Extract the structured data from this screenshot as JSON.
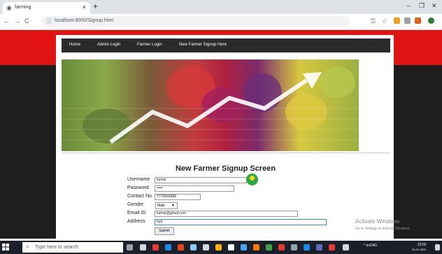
{
  "browser": {
    "tab_title": "farming",
    "url": "localhost:8000/Signup.html"
  },
  "nav": {
    "items": [
      "Home",
      "Admin Login",
      "Farmer Login",
      "New Farmer Signup Here"
    ]
  },
  "form": {
    "heading": "New Farmer Signup Screen",
    "username_label": "Username",
    "username_value": "kumar",
    "password_label": "Password",
    "password_value": "•••••",
    "contact_label": "Contact No",
    "contact_value": "7776666888",
    "gender_label": "Gender",
    "gender_value": "Male",
    "email_label": "Email ID",
    "email_value": "kumar@gmail.com",
    "address_label": "Address",
    "address_value": "hyd",
    "submit_label": "Submit"
  },
  "watermark": {
    "title": "Activate Windows",
    "subtitle": "Go to Settings to activate Windows."
  },
  "taskbar": {
    "search_placeholder": "Type here to search",
    "time": "22:02",
    "date": "26-01-2022"
  },
  "colors": {
    "header_red": "#e21313",
    "page_dark": "#1e1e1e",
    "nav_bg": "#2a2a2a",
    "pin_green": "#29a945"
  }
}
